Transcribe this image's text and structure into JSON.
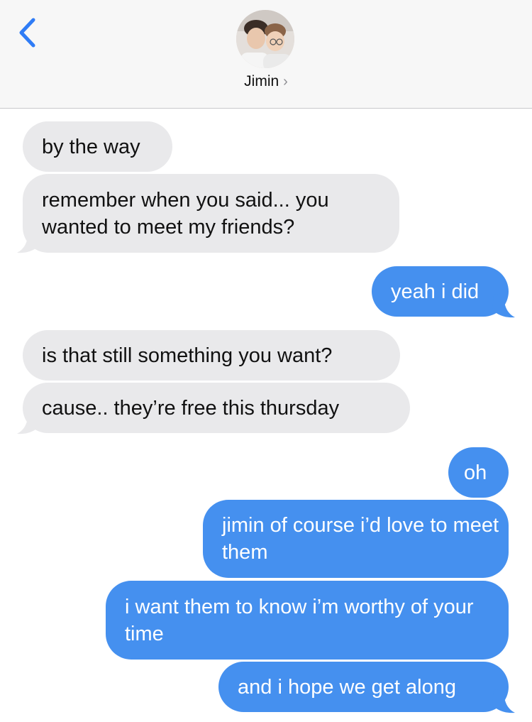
{
  "header": {
    "contact_name": "Jimin",
    "chevron": "›",
    "back_icon": "chevron-left-icon",
    "accent": "#2f7cf6"
  },
  "colors": {
    "incoming_bubble": "#e9e9eb",
    "outgoing_bubble": "#4590ef",
    "header_bg": "#f7f7f7"
  },
  "messages": [
    {
      "from": "contact",
      "text": "by the way"
    },
    {
      "from": "contact",
      "text": "remember when you said... you wanted to meet my friends?"
    },
    {
      "from": "me",
      "text": "yeah i did"
    },
    {
      "from": "contact",
      "text": "is that still something you want?"
    },
    {
      "from": "contact",
      "text": "cause.. they’re free this thursday"
    },
    {
      "from": "me",
      "text": "oh"
    },
    {
      "from": "me",
      "text": "jimin of course i’d love to meet them"
    },
    {
      "from": "me",
      "text": "i want them to know i’m worthy of your time"
    },
    {
      "from": "me",
      "text": "and i hope we get along"
    }
  ]
}
